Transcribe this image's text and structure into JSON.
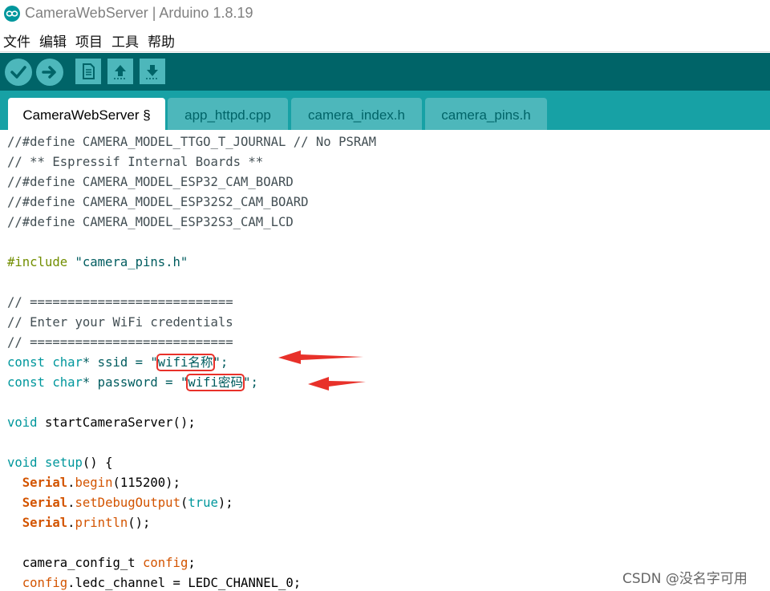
{
  "window": {
    "title": "CameraWebServer | Arduino 1.8.19"
  },
  "menu": [
    "文件",
    "编辑",
    "项目",
    "工具",
    "帮助"
  ],
  "toolbar": {
    "buttons": [
      {
        "name": "verify",
        "icon": "check-icon"
      },
      {
        "name": "upload",
        "icon": "arrow-right-icon"
      },
      {
        "name": "new",
        "icon": "new-file-icon"
      },
      {
        "name": "open",
        "icon": "arrow-up-icon"
      },
      {
        "name": "save",
        "icon": "arrow-down-icon"
      }
    ]
  },
  "tabs": [
    {
      "label": "CameraWebServer §",
      "active": true
    },
    {
      "label": "app_httpd.cpp",
      "active": false
    },
    {
      "label": "camera_index.h",
      "active": false
    },
    {
      "label": "camera_pins.h",
      "active": false
    }
  ],
  "code": {
    "l1": "//#define CAMERA_MODEL_TTGO_T_JOURNAL // No PSRAM",
    "l2": "// ** Espressif Internal Boards **",
    "l3": "//#define CAMERA_MODEL_ESP32_CAM_BOARD",
    "l4": "//#define CAMERA_MODEL_ESP32S2_CAM_BOARD",
    "l5": "//#define CAMERA_MODEL_ESP32S3_CAM_LCD",
    "l7_kw": "#include",
    "l7_str": "\"camera_pins.h\"",
    "l9": "// ===========================",
    "l10": "// Enter your WiFi credentials",
    "l11": "// ===========================",
    "l12": {
      "const": "const",
      "char": "char",
      "mid": "* ssid = \"",
      "value": "wifi名称",
      "end": "\";"
    },
    "l13": {
      "const": "const",
      "char": "char",
      "mid": "* password = \"",
      "value": "wifi密码",
      "end": "\";"
    },
    "l15": {
      "void": "void",
      "rest": " startCameraServer();"
    },
    "l17": {
      "void": "void",
      "fn": "setup",
      "rest": "() {"
    },
    "l18": {
      "obj": "Serial",
      "dot": ".",
      "fn": "begin",
      "rest": "(115200);"
    },
    "l19": {
      "obj": "Serial",
      "dot": ".",
      "fn": "setDebugOutput",
      "p1": "(",
      "val": "true",
      "p2": ");"
    },
    "l20": {
      "obj": "Serial",
      "dot": ".",
      "fn": "println",
      "rest": "();"
    },
    "l22": {
      "type": "camera_config_t",
      "var": "config",
      "end": ";"
    },
    "l23": {
      "obj": "config",
      "rest": ".ledc_channel = LEDC_CHANNEL_0;"
    }
  },
  "annotation_color": "#e8312a",
  "watermark": "CSDN @没名字可用"
}
